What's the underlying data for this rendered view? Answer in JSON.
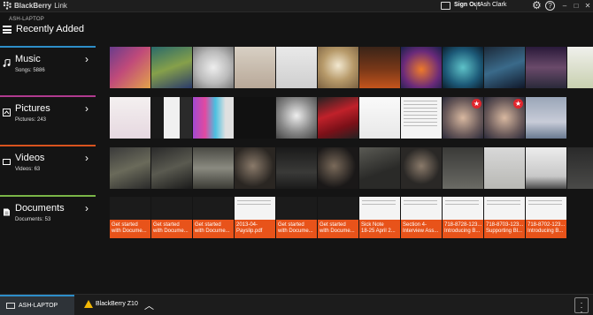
{
  "app": {
    "brand": "BlackBerry",
    "brand_suffix": "Link"
  },
  "account": {
    "sign_out": "Sign Out",
    "user": "Ash Clark"
  },
  "header": {
    "device": "ASH-LAPTOP",
    "title": "Recently Added"
  },
  "categories": [
    {
      "label": "Music",
      "count": "Songs: 5886",
      "accent": "#2d8ec9"
    },
    {
      "label": "Pictures",
      "count": "Pictures: 243",
      "accent": "#b03a8f"
    },
    {
      "label": "Videos",
      "count": "Videos: 63",
      "accent": "#d9531e"
    },
    {
      "label": "Documents",
      "count": "Documents: 53",
      "accent": "#7ab648"
    }
  ],
  "documents": [
    "Get started\nwith Docume...",
    "Get started\nwith Docume...",
    "Get started\nwith Docume...",
    "2013-04-\nPayslip.pdf",
    "Get started\nwith Docume...",
    "Get started\nwith Docume...",
    "Sick Note\n18-25 April 2...",
    "Section 4-\nInterview Ass...",
    "718-8728-123...\nIntroducing B...",
    "718-8703-123...\nSupporting Bl...",
    "718-8702-123...\nIntroducing B..."
  ],
  "bottom": {
    "device_tab": "ASH-LAPTOP",
    "phone_tab": "BlackBerry Z10"
  },
  "colors": {
    "accent_blue": "#2d8ec9",
    "doc_orange": "#e8531a",
    "warning": "#f2b705",
    "badge_red": "#e0262d"
  }
}
